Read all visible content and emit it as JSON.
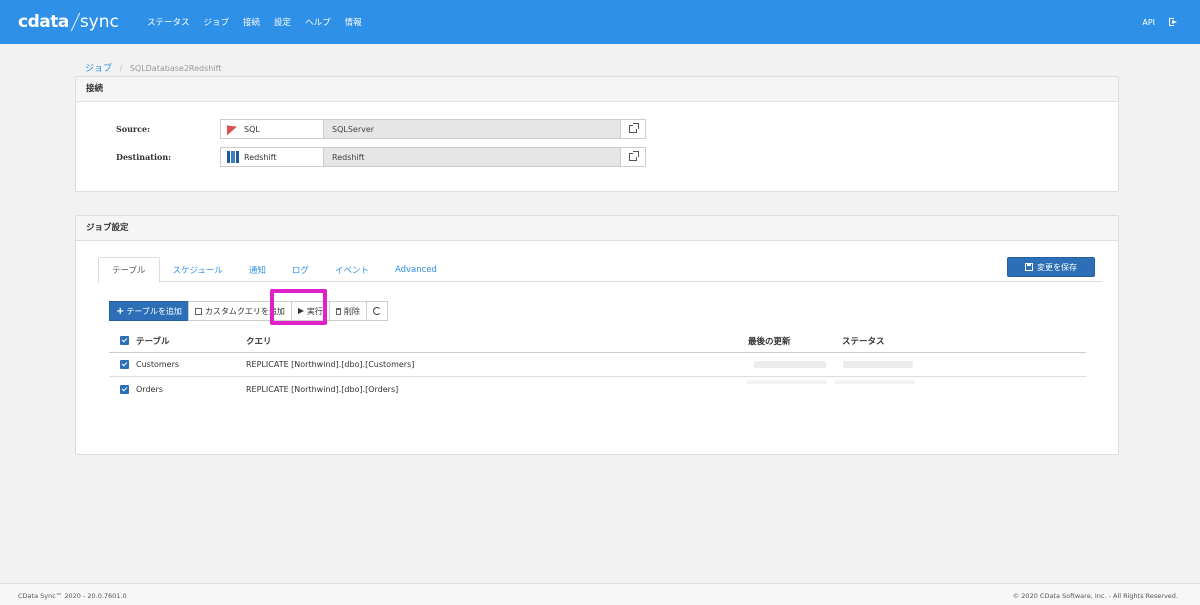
{
  "app": {
    "logo_main": "cdata",
    "logo_sub": "sync"
  },
  "nav": {
    "items": [
      "ステータス",
      "ジョブ",
      "接続",
      "設定",
      "ヘルプ",
      "情報"
    ],
    "api_label": "API"
  },
  "breadcrumb": {
    "root": "ジョブ",
    "current": "SQLDatabase2Redshift"
  },
  "connection": {
    "title": "接続",
    "source": {
      "label": "Source:",
      "type": "SQL",
      "name": "SQLServer"
    },
    "destination": {
      "label": "Destination:",
      "type": "Redshift",
      "name": "Redshift"
    }
  },
  "job_settings": {
    "title": "ジョブ設定",
    "tabs": [
      "テーブル",
      "スケジュール",
      "通知",
      "ログ",
      "イベント",
      "Advanced"
    ],
    "save_label": "変更を保存",
    "toolbar": {
      "add_table": "テーブルを追加",
      "custom_query": "カスタムクエリを追加",
      "run": "実行",
      "delete": "削除"
    },
    "table": {
      "headers": {
        "table": "テーブル",
        "query": "クエリ",
        "last_updated": "最後の更新",
        "status": "ステータス"
      },
      "rows": [
        {
          "table": "Customers",
          "query": "REPLICATE [Northwind].[dbo].[Customers]"
        },
        {
          "table": "Orders",
          "query": "REPLICATE [Northwind].[dbo].[Orders]"
        }
      ]
    }
  },
  "footer": {
    "version": "CData Sync™ 2020 - 20.0.7601.0",
    "copyright": "© 2020 CData Software, Inc. - All Rights Reserved."
  },
  "colors": {
    "primary": "#2f90e8",
    "button": "#2c6fb7",
    "highlight": "#e020c8"
  }
}
